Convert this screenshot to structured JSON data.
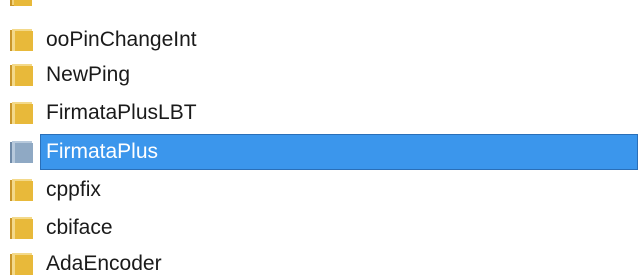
{
  "folders": [
    {
      "name": "",
      "selected": false,
      "partial": true
    },
    {
      "name": "ooPinChangeInt",
      "selected": false
    },
    {
      "name": "NewPing",
      "selected": false
    },
    {
      "name": "FirmataPlusLBT",
      "selected": false
    },
    {
      "name": "FirmataPlus",
      "selected": true
    },
    {
      "name": "cppfix",
      "selected": false
    },
    {
      "name": "cbiface",
      "selected": false
    },
    {
      "name": "AdaEncoder",
      "selected": false
    }
  ],
  "colors": {
    "selection": "#3b96ec",
    "folder": "#e8b93a",
    "folder_selected": "#8fa9c4"
  },
  "icons": {
    "folder": "folder-icon",
    "folder_selected": "folder-icon-selected"
  }
}
